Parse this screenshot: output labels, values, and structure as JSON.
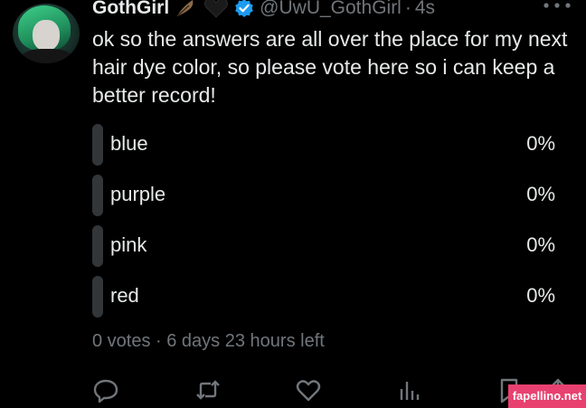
{
  "tweet": {
    "display_name": "GothGirl",
    "handle": "@UwU_GothGirl",
    "separator": "·",
    "time": "4s",
    "text": "ok so the answers are all over the place for my next hair dye color, so please vote here so i can keep a better record!",
    "icons": {
      "name_emojis": [
        "feather-emoji-icon",
        "black-heart-emoji-icon"
      ],
      "verified": "verified-badge-icon",
      "more": "more-options-icon"
    }
  },
  "poll": {
    "options": [
      {
        "label": "blue",
        "percent": "0%"
      },
      {
        "label": "purple",
        "percent": "0%"
      },
      {
        "label": "pink",
        "percent": "0%"
      },
      {
        "label": "red",
        "percent": "0%"
      }
    ],
    "meta": "0 votes · 6 days 23 hours left"
  },
  "actions": [
    "reply-icon",
    "retweet-icon",
    "like-icon",
    "views-icon",
    "bookmark-icon",
    "share-icon"
  ],
  "watermark": "fapellino.net",
  "colors": {
    "background": "#000000",
    "text_primary": "#e7e9ea",
    "text_secondary": "#71767b",
    "verified_blue": "#1d9bf0",
    "poll_bar": "#333639",
    "watermark_bg": "#e8416f"
  }
}
